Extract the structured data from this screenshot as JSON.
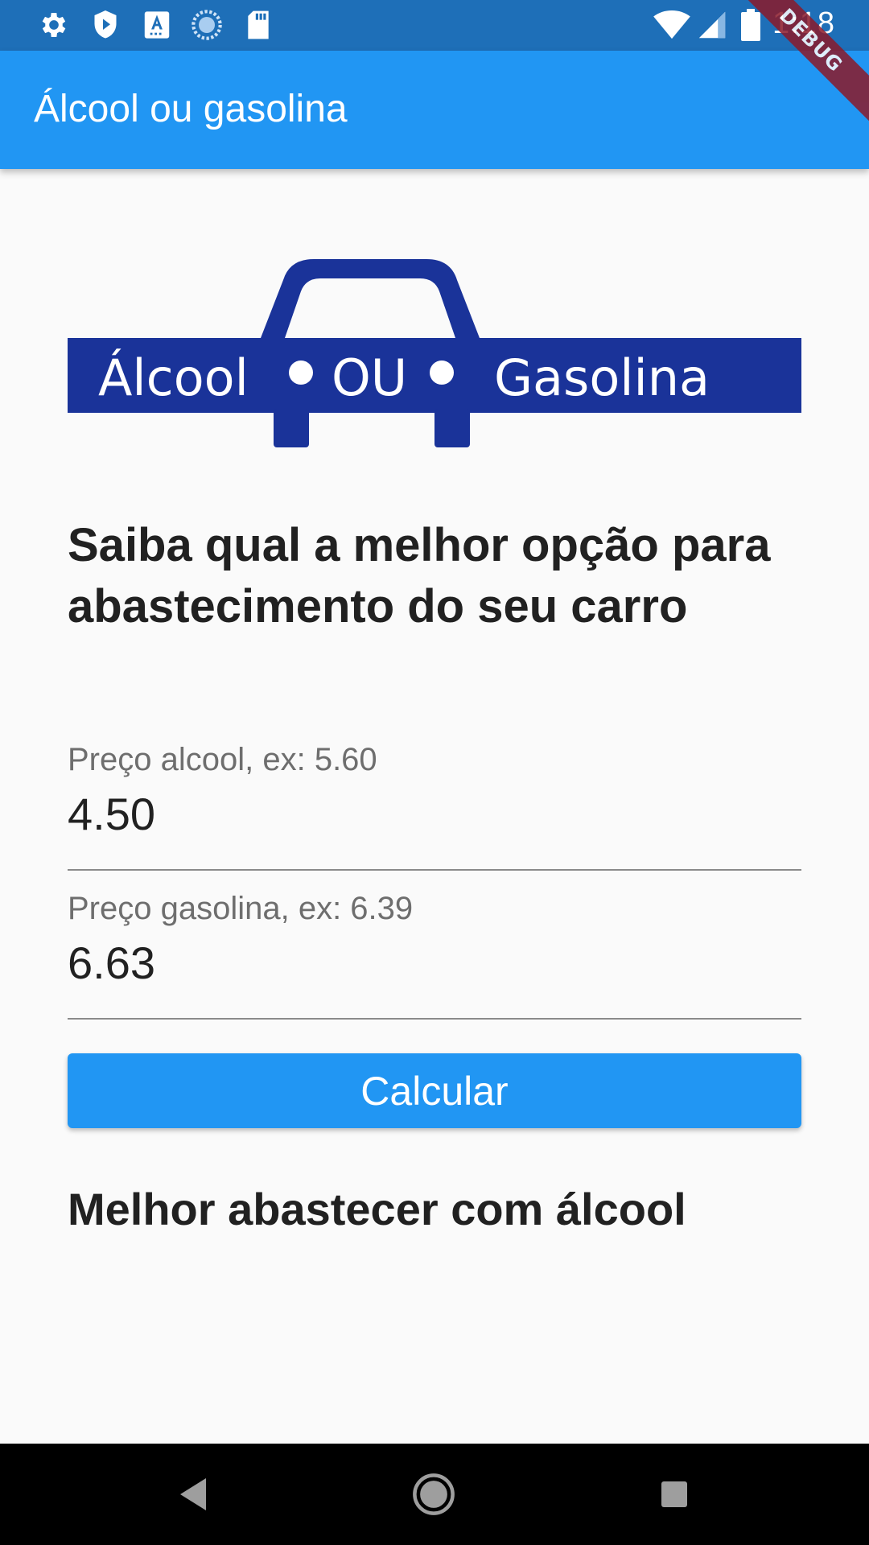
{
  "status_bar": {
    "time": "1:18",
    "icons": [
      "settings-icon",
      "shield-icon",
      "font-icon",
      "sync-icon",
      "sd-card-icon",
      "wifi-icon",
      "signal-icon",
      "battery-icon"
    ]
  },
  "app_bar": {
    "title": "Álcool ou gasolina",
    "background": "#2196f3"
  },
  "debug_banner": "DEBUG",
  "logo": {
    "word_left": "Álcool",
    "word_middle": "OU",
    "word_right": "Gasolina",
    "color": "#1a3399"
  },
  "headline": "Saiba qual a melhor opção para abastecimento do seu carro",
  "fields": {
    "alcool": {
      "label": "Preço alcool, ex: 5.60",
      "value": "4.50"
    },
    "gasolina": {
      "label": "Preço gasolina, ex: 6.39",
      "value": "6.63"
    }
  },
  "calc_button": {
    "label": "Calcular"
  },
  "result": "Melhor abastecer com álcool",
  "nav_bar": {
    "buttons": [
      "back-icon",
      "home-icon",
      "recents-icon"
    ]
  }
}
